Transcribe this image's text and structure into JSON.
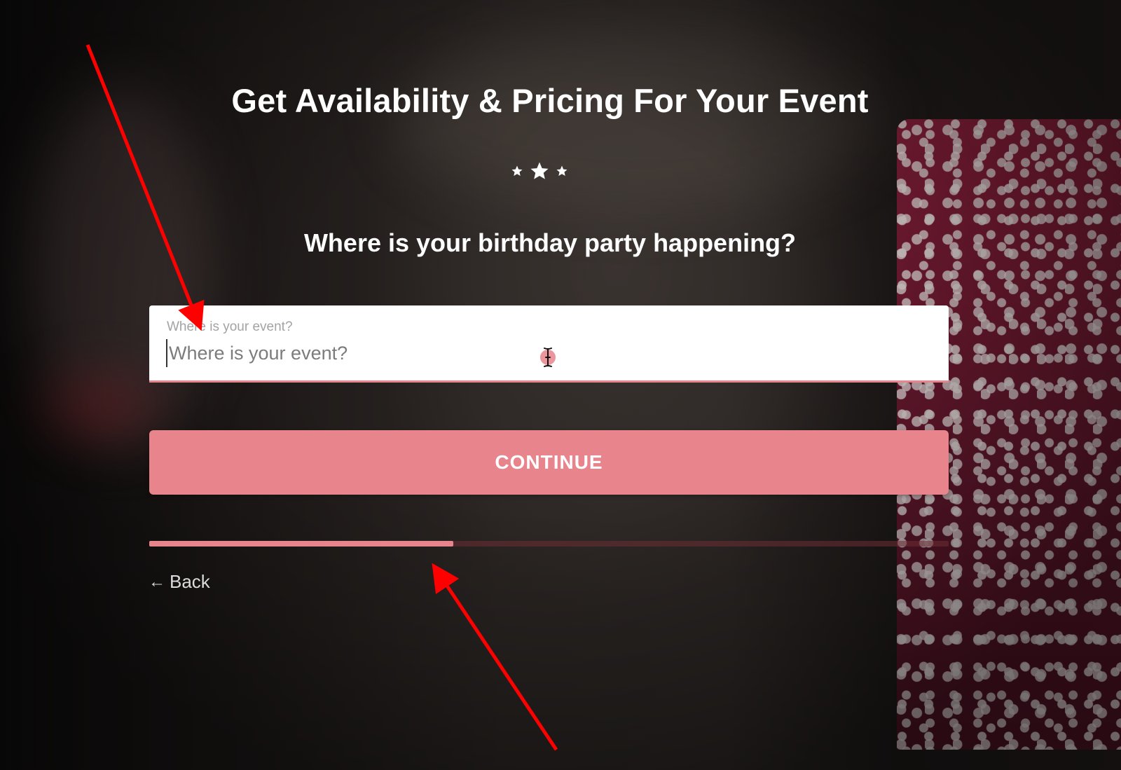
{
  "header": {
    "title": "Get Availability & Pricing For Your Event"
  },
  "rating": {
    "icon": "stars-icon",
    "count": 3
  },
  "question": {
    "text": "Where is your birthday party happening?"
  },
  "location_field": {
    "label": "Where is your event?",
    "placeholder": "Where is your event?",
    "value": ""
  },
  "continue_button": {
    "label": "CONTINUE"
  },
  "progress": {
    "fraction": 0.38
  },
  "back_link": {
    "arrow": "←",
    "label": "Back"
  },
  "colors": {
    "accent": "#e8848b",
    "annotation_arrow": "#ff0000"
  }
}
